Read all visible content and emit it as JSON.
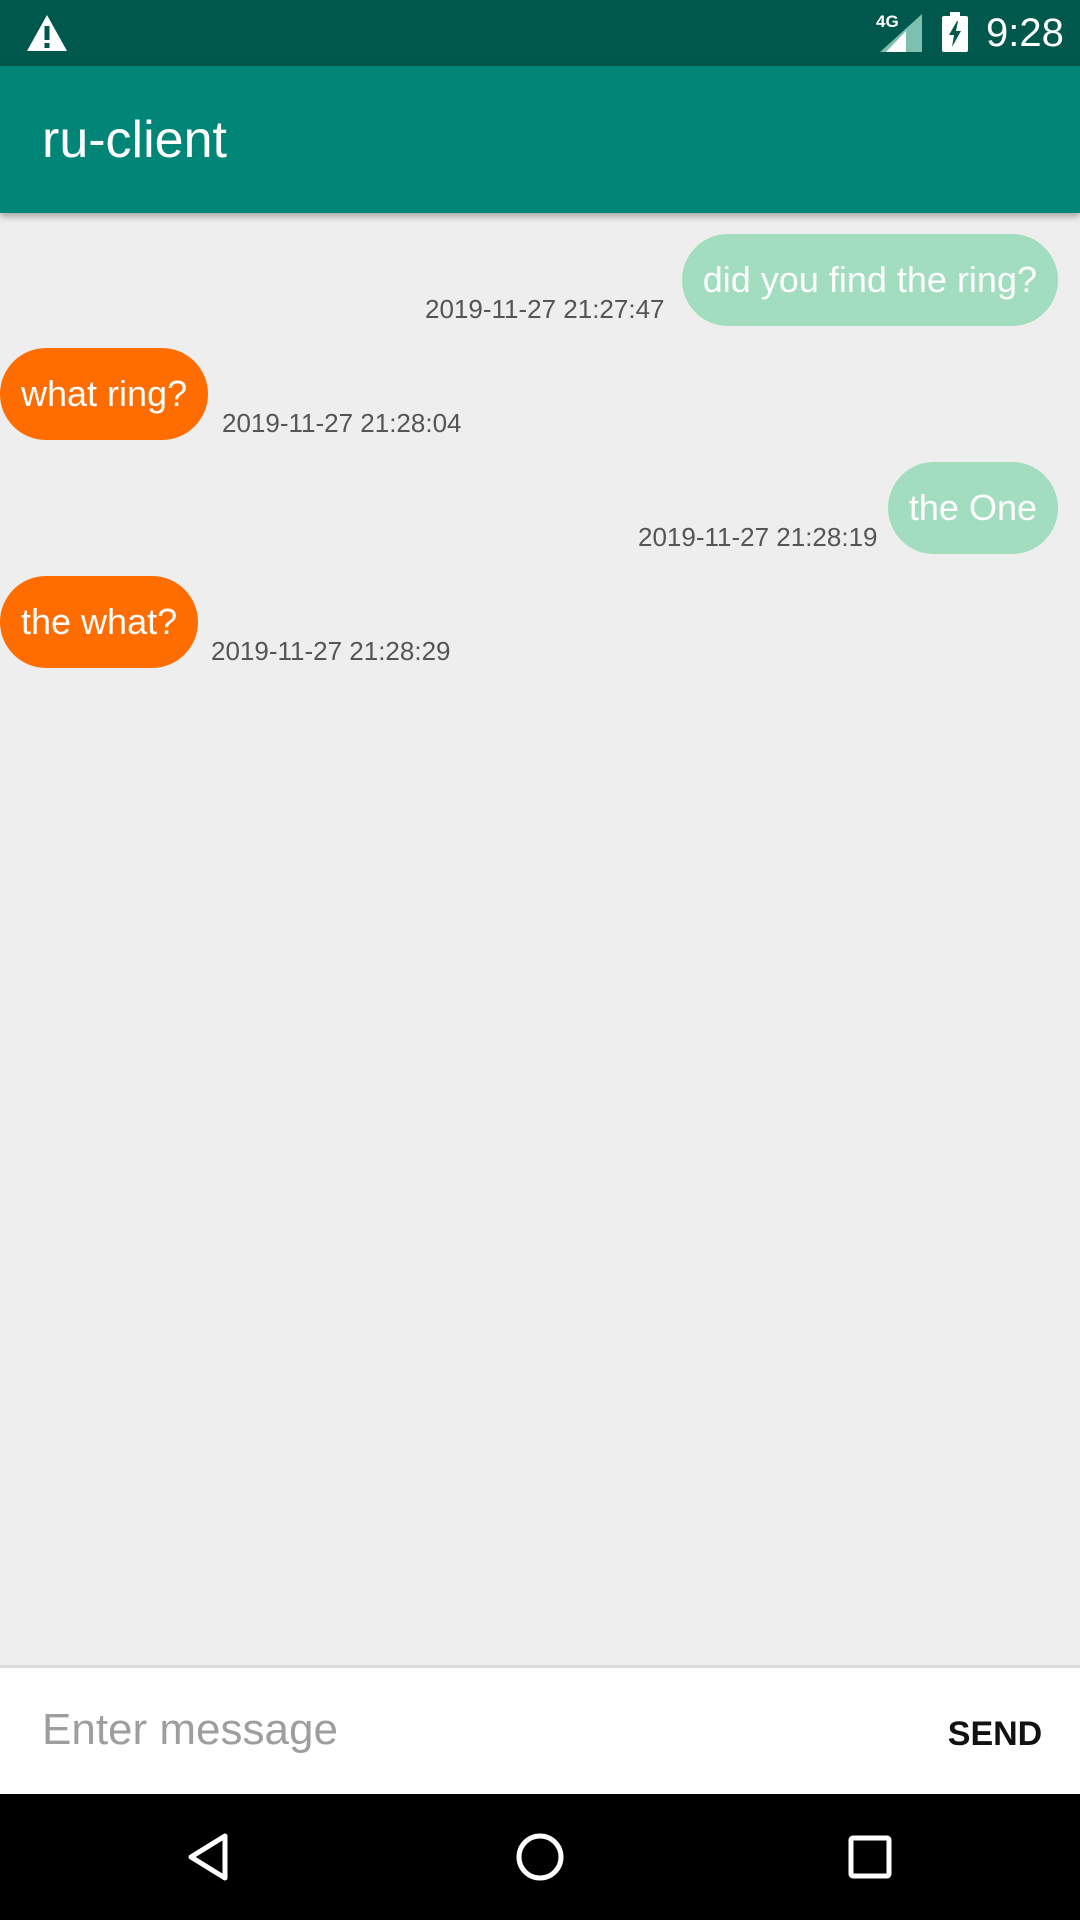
{
  "status_bar": {
    "network_label": "4G",
    "time": "9:28",
    "icons": [
      "warning-icon",
      "signal-icon",
      "battery-charging-icon"
    ]
  },
  "app_bar": {
    "title": "ru-client",
    "color": "#008577"
  },
  "messages": [
    {
      "direction": "sent",
      "text": "did you find the ring?",
      "timestamp": "2019-11-27 21:27:47"
    },
    {
      "direction": "received",
      "text": "what ring?",
      "timestamp": "2019-11-27 21:28:04"
    },
    {
      "direction": "sent",
      "text": "the One",
      "timestamp": "2019-11-27 21:28:19"
    },
    {
      "direction": "received",
      "text": "the what?",
      "timestamp": "2019-11-27 21:28:29"
    }
  ],
  "colors": {
    "sent_bubble": "#A2DDC0",
    "received_bubble": "#FF6D00",
    "status_bar": "#00574B"
  },
  "composer": {
    "placeholder": "Enter message",
    "value": "",
    "send_label": "SEND"
  },
  "nav_bar": {
    "icons": [
      "back-icon",
      "home-icon",
      "recents-icon"
    ]
  }
}
